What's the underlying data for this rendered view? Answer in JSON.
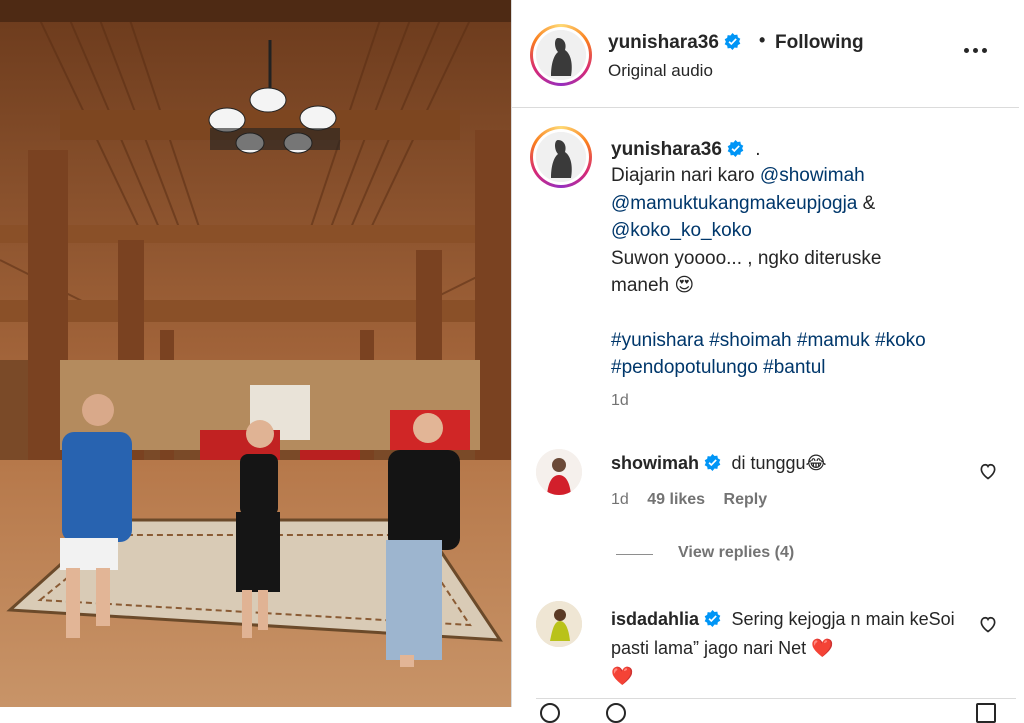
{
  "header": {
    "username": "yunishara36",
    "separator": "•",
    "follow_status": "Following",
    "audio_label": "Original audio"
  },
  "caption": {
    "username": "yunishara36",
    "dot": ".",
    "line1": "Diajarin nari karo ",
    "mention1": "@showimah",
    "mention2": "@mamuktukangmakeupjogja",
    "amp": " &",
    "mention3": "@koko_ko_koko",
    "line2": "Suwon yoooo... , ngko diteruske",
    "line3": "maneh ",
    "emoji_heart_eyes": "😍",
    "hashtags_line1": "#yunishara #shoimah #mamuk #koko",
    "hashtags_line2": "#pendopotulungo #bantul",
    "time": "1d"
  },
  "comments": [
    {
      "username": "showimah",
      "text": "di tunggu",
      "emoji": "😂",
      "time": "1d",
      "likes": "49 likes",
      "reply": "Reply",
      "view_replies": "View replies (4)"
    },
    {
      "username": "isdadahlia",
      "text": "Sering kejogja n main keSoi pasti lama” jago nari Net ",
      "heart1": "❤️",
      "heart2": "❤️"
    }
  ],
  "icons": {
    "verified": "verified-badge-icon",
    "more": "more-options-icon",
    "like": "heart-icon"
  },
  "colors": {
    "verified_blue": "#0095f6",
    "link_blue": "#00376b",
    "muted": "#737373"
  }
}
